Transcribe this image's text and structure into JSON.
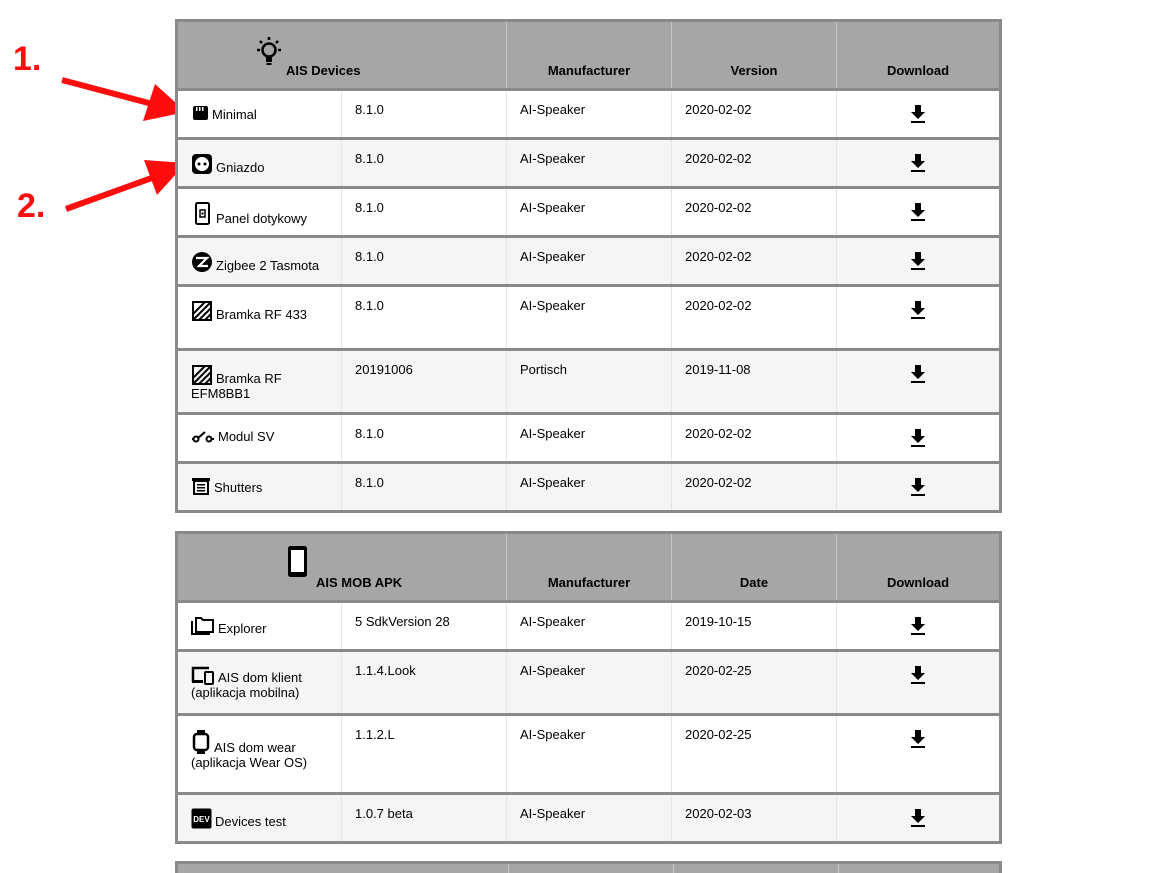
{
  "annotations": {
    "label1": "1.",
    "label2": "2.",
    "arrow_color": "#ff0d0d"
  },
  "devices_table": {
    "headers": {
      "name": "AIS Devices",
      "manufacturer": "Manufacturer",
      "version": "Version",
      "download": "Download"
    },
    "header_icon": "lightbulb-icon",
    "rows": [
      {
        "icon": "sd-card-icon",
        "name": "Minimal",
        "version": "8.1.0",
        "manufacturer": "AI-Speaker",
        "date": "2020-02-02"
      },
      {
        "icon": "power-socket-icon",
        "name": "Gniazdo",
        "version": "8.1.0",
        "manufacturer": "AI-Speaker",
        "date": "2020-02-02"
      },
      {
        "icon": "touch-panel-icon",
        "name": "Panel dotykowy",
        "version": "8.1.0",
        "manufacturer": "AI-Speaker",
        "date": "2020-02-02"
      },
      {
        "icon": "zigbee-icon",
        "name": "Zigbee 2 Tasmota",
        "version": "8.1.0",
        "manufacturer": "AI-Speaker",
        "date": "2020-02-02"
      },
      {
        "icon": "rf-bridge-icon",
        "name": "Bramka RF 433",
        "version": "8.1.0",
        "manufacturer": "AI-Speaker",
        "date": "2020-02-02"
      },
      {
        "icon": "rf-bridge-icon",
        "name": "Bramka RF EFM8BB1",
        "version": "20191006",
        "manufacturer": "Portisch",
        "date": "2019-11-08"
      },
      {
        "icon": "switch-icon",
        "name": "Modul SV",
        "version": "8.1.0",
        "manufacturer": "AI-Speaker",
        "date": "2020-02-02"
      },
      {
        "icon": "window-shutter-icon",
        "name": "Shutters",
        "version": "8.1.0",
        "manufacturer": "AI-Speaker",
        "date": "2020-02-02"
      }
    ]
  },
  "apk_table": {
    "headers": {
      "name": "AIS MOB APK",
      "manufacturer": "Manufacturer",
      "date": "Date",
      "download": "Download"
    },
    "header_icon": "cellphone-icon",
    "rows": [
      {
        "icon": "folder-multiple-icon",
        "name": "Explorer",
        "version": "5 SdkVersion 28",
        "manufacturer": "AI-Speaker",
        "date": "2019-10-15"
      },
      {
        "icon": "devices-icon",
        "name": "AIS dom klient (aplikacja mobilna)",
        "version": "1.1.4.Look",
        "manufacturer": "AI-Speaker",
        "date": "2020-02-25"
      },
      {
        "icon": "watch-icon",
        "name": "AIS dom wear (aplikacja Wear OS)",
        "version": "1.1.2.L",
        "manufacturer": "AI-Speaker",
        "date": "2020-02-25"
      },
      {
        "icon": "dev-badge-icon",
        "name": "Devices test",
        "version": "1.0.7 beta",
        "manufacturer": "AI-Speaker",
        "date": "2020-02-03"
      }
    ]
  }
}
